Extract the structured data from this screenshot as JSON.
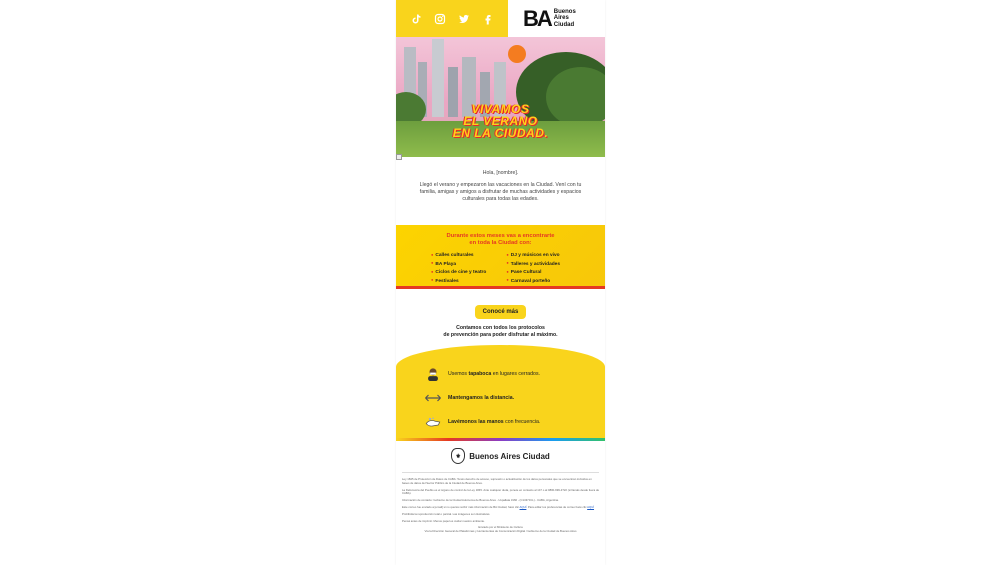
{
  "header": {
    "social_icons": [
      "tiktok-icon",
      "instagram-icon",
      "twitter-icon",
      "facebook-icon"
    ],
    "brand_mark": "BA",
    "brand_line1": "Buenos",
    "brand_line2": "Aires",
    "brand_line3": "Ciudad",
    "color_yellow": "#f9d41c"
  },
  "hero": {
    "title_line1": "VIVAMOS",
    "title_line2": "EL VERANO",
    "title_line3": "EN LA CIUDAD."
  },
  "greeting": {
    "hello": "Hola, [nombre].",
    "body": "Llegó el verano y empezaron las vacaciones en la Ciudad. Vení con tu familia, amigas y amigos a disfrutar de muchas actividades y espacios culturales para todas las edades."
  },
  "activities": {
    "heading_line1": "Durante estos meses vas a encontrarte",
    "heading_line2": "en toda la Ciudad con:",
    "left": [
      "Calles culturales",
      "BA Playa",
      "Ciclos de cine y teatro",
      "Festivales"
    ],
    "right": [
      "DJ y músicos en vivo",
      "Talleres y actividades",
      "Pase Cultural",
      "Carnaval porteño"
    ]
  },
  "cta": {
    "label": "Conocé más"
  },
  "protocol": {
    "line1": "Contamos con todos los protocolos",
    "line2": "de prevención para poder disfrutar al máximo.",
    "items": [
      {
        "pre": "Usemos ",
        "bold": "tapaboca",
        "post": " en lugares cerrados."
      },
      {
        "pre": "",
        "bold": "Mantengamos la distancia.",
        "post": ""
      },
      {
        "pre": "",
        "bold": "Lavémonos las manos",
        "post": " con frecuencia."
      }
    ]
  },
  "footer": {
    "brand": "Buenos Aires Ciudad",
    "legal1": "Ley 1845 de Protección de Datos de CABA: Tenés derecho de acceso, supresión o actualización de los datos personales que se encuentran incluidos en bases de datos del Sector Público de la Ciudad de Buenos Aires.",
    "legal2": "La Defensoría del Pueblo es el órgano de control de la Ley 1845. Ante cualquier duda, ponete en contacto al 147 o al 0800-999-3722 (si llamás desde fuera de CABA).",
    "legal3": "Información de contacto: Gobierno de la Ciudad Autónoma de Buenos Aires - Uspallata 3160 - (C1437JCL) - CABA, Argentina.",
    "legal4_pre": "Este correo fue enviado a [email] si no querés recibir más información de BA Ciudad, hacé clic ",
    "legal4_link": "AQUÍ",
    "legal4_mid": ". Para editar tus preferencias de correo hacé clic ",
    "legal4_link2": "AQUÍ",
    "legal5": "Prohibida la reproducción total o parcial. Las imágenes son ilustrativas.",
    "legal6": "Pensá antes de imprimir. Menos papel es cuidar nuestro ambiente.",
    "legal7": "Enviado por el Ministerio de Cultura",
    "legal8": "Vía la Dirección General de Plataformas y Herramientas de Comunicación Digital / Gobierno de la Ciudad de Buenos Aires"
  }
}
